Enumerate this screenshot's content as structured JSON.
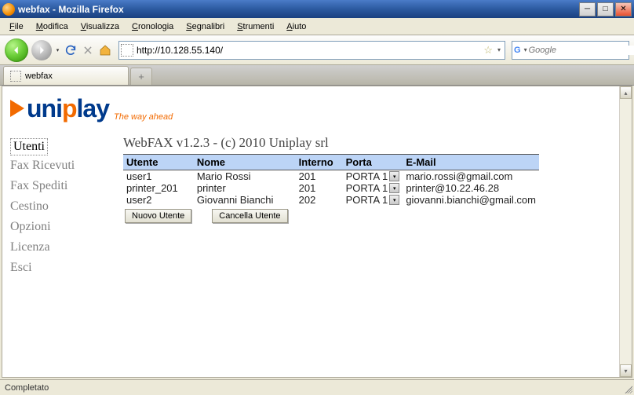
{
  "window": {
    "title": "webfax - Mozilla Firefox"
  },
  "menu": [
    "File",
    "Modifica",
    "Visualizza",
    "Cronologia",
    "Segnalibri",
    "Strumenti",
    "Aiuto"
  ],
  "toolbar": {
    "url": "http://10.128.55.140/",
    "search_placeholder": "Google"
  },
  "tab": {
    "label": "webfax",
    "newtab_glyph": "+"
  },
  "logo": {
    "part1": "uni",
    "part2": "p",
    "part3": "lay",
    "tagline": "The way ahead"
  },
  "sidebar": {
    "items": [
      {
        "label": "Utenti",
        "active": true
      },
      {
        "label": "Fax Ricevuti",
        "active": false
      },
      {
        "label": "Fax Spediti",
        "active": false
      },
      {
        "label": "Cestino",
        "active": false
      },
      {
        "label": "Opzioni",
        "active": false
      },
      {
        "label": "Licenza",
        "active": false
      },
      {
        "label": "Esci",
        "active": false
      }
    ]
  },
  "main": {
    "app_title": "WebFAX v1.2.3 - (c) 2010 Uniplay srl",
    "headers": {
      "user": "Utente",
      "name": "Nome",
      "ext": "Interno",
      "port": "Porta",
      "email": "E-Mail"
    },
    "rows": [
      {
        "user": "user1",
        "name": "Mario Rossi",
        "ext": "201",
        "port": "PORTA 1",
        "email": "mario.rossi@gmail.com"
      },
      {
        "user": "printer_201",
        "name": "printer",
        "ext": "201",
        "port": "PORTA 1",
        "email": "printer@10.22.46.28"
      },
      {
        "user": "user2",
        "name": "Giovanni Bianchi",
        "ext": "202",
        "port": "PORTA 1",
        "email": "giovanni.bianchi@gmail.com"
      }
    ],
    "buttons": {
      "new": "Nuovo Utente",
      "del": "Cancella Utente"
    }
  },
  "status": {
    "text": "Completato"
  }
}
